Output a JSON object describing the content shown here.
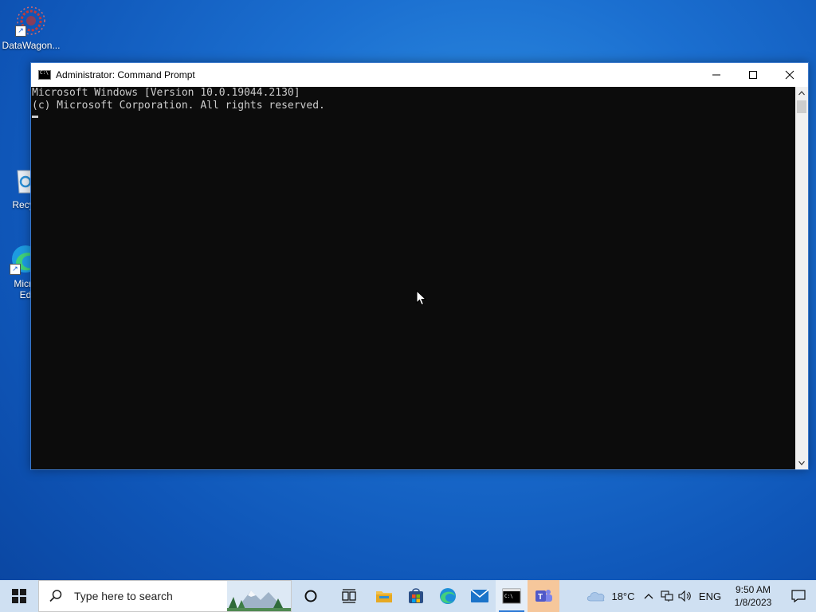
{
  "desktop": {
    "icons": [
      {
        "label": "DataWagon...",
        "icon": "datawagon-icon"
      },
      {
        "label": "Recyc",
        "icon": "recycle-bin-icon"
      },
      {
        "label": "Micro",
        "label2": "Ed",
        "icon": "edge-icon"
      }
    ]
  },
  "window": {
    "title": "Administrator:  Command Prompt",
    "console_lines": [
      "Microsoft Windows [Version 10.0.19044.2130]",
      "(c) Microsoft Corporation. All rights reserved."
    ]
  },
  "taskbar": {
    "search_placeholder": "Type here to search",
    "apps": [
      "task-view",
      "file-explorer",
      "microsoft-store",
      "edge",
      "mail",
      "command-prompt",
      "teams"
    ],
    "weather": "18°C",
    "language": "ENG",
    "time": "9:50 AM",
    "date": "1/8/2023"
  },
  "colors": {
    "console_bg": "#0c0c0c",
    "console_fg": "#cccccc",
    "taskbar_bg": "#cfe0f2"
  }
}
